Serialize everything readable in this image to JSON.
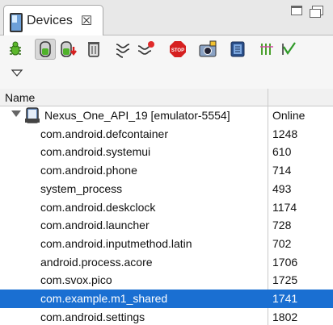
{
  "tab": {
    "label": "Devices",
    "close_glyph": "☒"
  },
  "toolbar": {
    "icons": [
      "debug-icon",
      "update-heap-icon",
      "dump-hprof-icon",
      "cause-gc-icon",
      "update-threads-icon",
      "start-method-profiling-icon",
      "stop-process-icon",
      "screen-capture-icon",
      "dump-view-hierarchy-icon",
      "capture-gl-frames-icon",
      "systrace-icon",
      "view-menu-icon"
    ]
  },
  "header": {
    "name": "Name"
  },
  "device": {
    "name": "Nexus_One_API_19 [emulator-5554]",
    "status": "Online"
  },
  "processes": [
    {
      "name": "com.android.defcontainer",
      "pid": "1248"
    },
    {
      "name": "com.android.systemui",
      "pid": "610"
    },
    {
      "name": "com.android.phone",
      "pid": "714"
    },
    {
      "name": "system_process",
      "pid": "493"
    },
    {
      "name": "com.android.deskclock",
      "pid": "1174"
    },
    {
      "name": "com.android.launcher",
      "pid": "728"
    },
    {
      "name": "com.android.inputmethod.latin",
      "pid": "702"
    },
    {
      "name": "android.process.acore",
      "pid": "1706"
    },
    {
      "name": "com.svox.pico",
      "pid": "1725"
    },
    {
      "name": "com.example.m1_shared",
      "pid": "1741",
      "selected": true
    },
    {
      "name": "com.android.settings",
      "pid": "1802"
    }
  ],
  "colors": {
    "selection": "#1a6fd2",
    "toolbar_bg": "#f6f6f6"
  }
}
